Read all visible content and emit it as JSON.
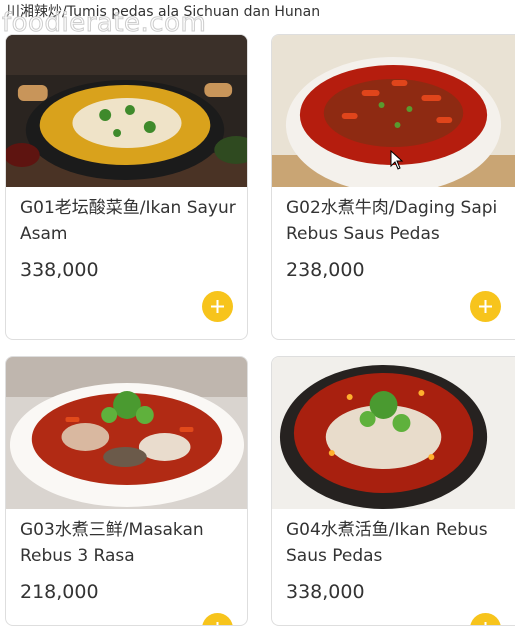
{
  "section": {
    "title": "川湘辣炒/Tumis pedas ala Sichuan dan Hunan"
  },
  "watermark": "foodierate.com",
  "colors": {
    "accent": "#f7c41c",
    "card_border": "#dedede",
    "text": "#333333"
  },
  "items": [
    {
      "name": "G01老坛酸菜鱼/Ikan Sayur Asam",
      "price": "338,000",
      "add_icon": "plus-icon"
    },
    {
      "name": "G02水煮牛肉/Daging Sapi Rebus Saus Pedas",
      "price": "238,000",
      "add_icon": "plus-icon"
    },
    {
      "name": "G03水煮三鲜/Masakan Rebus 3 Rasa",
      "price": "218,000",
      "add_icon": "plus-icon"
    },
    {
      "name": "G04水煮活鱼/Ikan Rebus Saus Pedas",
      "price": "338,000",
      "add_icon": "plus-icon"
    }
  ]
}
